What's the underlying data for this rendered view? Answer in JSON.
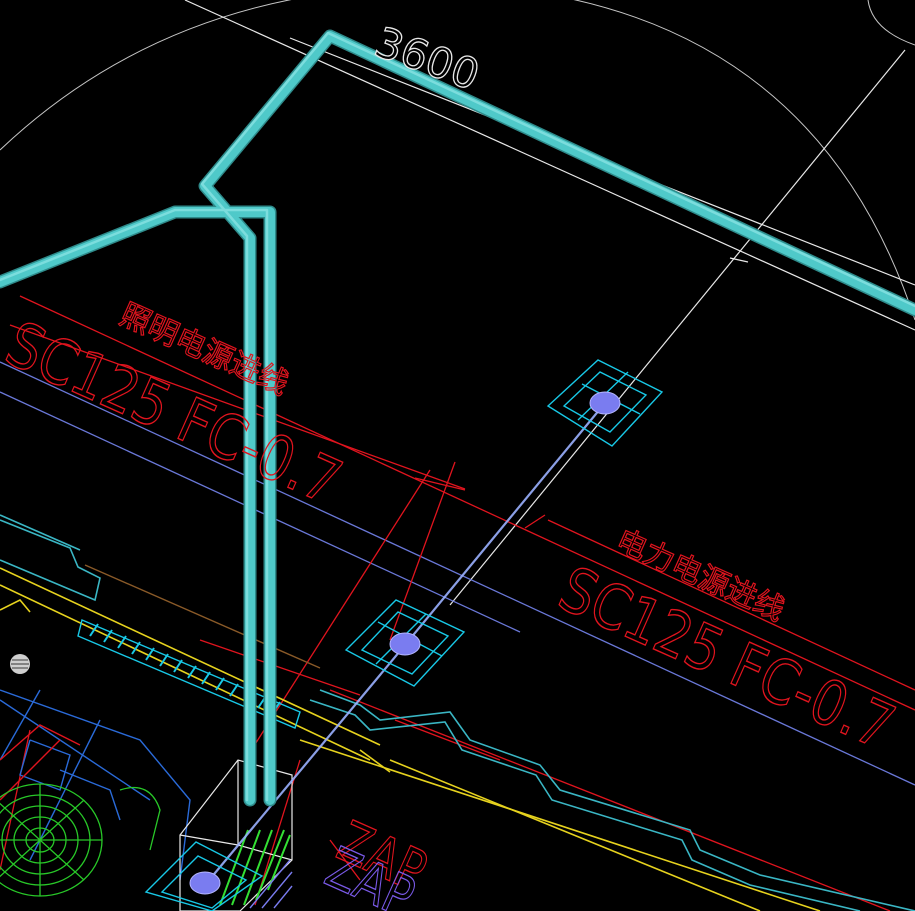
{
  "drawing": {
    "background": "#000000",
    "colors": {
      "pipe": "#4fc9c9",
      "pipe_highlight": "#8fe6e6",
      "annotation": "#e0141e",
      "leader_white": "#e8e8e8",
      "grid_blue": "#6a78d8",
      "wall_yellow": "#e6d21e",
      "outline_cyan": "#3ab6c4",
      "cyan_bright": "#18c8e6",
      "junction_fill": "#7a7cf0",
      "fan_green": "#28c828",
      "hatch_green": "#34e034",
      "brown": "#8a5a28",
      "blue_equipment": "#2a6ad8",
      "magenta_text": "#7a5ae8",
      "cable": "#9ab0ff"
    },
    "labels": {
      "dimension": "3600",
      "lighting_title": "照明电源进线",
      "lighting_spec": "SC125 FC-0.7",
      "power_title": "电力电源进线",
      "power_spec": "SC125 FC-0.7",
      "panel_tag": "ZAP"
    },
    "icons": {
      "junction_box": "junction-box-icon",
      "exhaust_fan": "exhaust-fan-icon",
      "floor_drain": "floor-drain-icon"
    }
  }
}
